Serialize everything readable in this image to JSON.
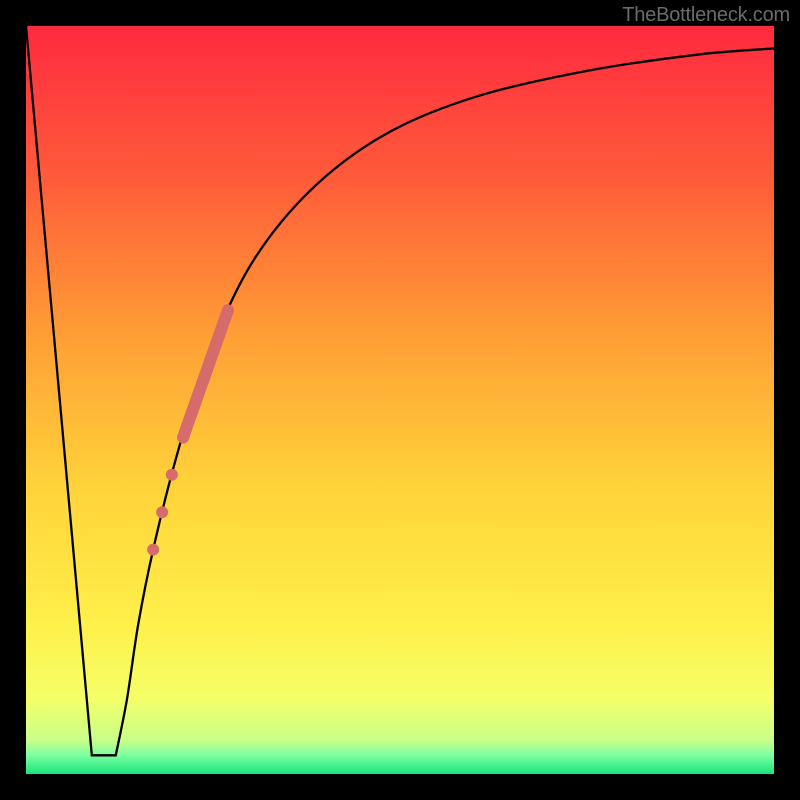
{
  "attribution": "TheBottleneck.com",
  "chart_data": {
    "type": "line",
    "title": "",
    "xlabel": "",
    "ylabel": "",
    "xlim": [
      0,
      100
    ],
    "ylim": [
      0,
      100
    ],
    "gradient": [
      {
        "stop": 0.0,
        "color": "#ff2a3f"
      },
      {
        "stop": 0.2,
        "color": "#ff5a3a"
      },
      {
        "stop": 0.42,
        "color": "#ffa035"
      },
      {
        "stop": 0.62,
        "color": "#ffd43a"
      },
      {
        "stop": 0.8,
        "color": "#fff04a"
      },
      {
        "stop": 0.9,
        "color": "#f4ff68"
      },
      {
        "stop": 0.955,
        "color": "#c9ff8a"
      },
      {
        "stop": 0.975,
        "color": "#7bffa0"
      },
      {
        "stop": 1.0,
        "color": "#18e57e"
      }
    ],
    "left_line": {
      "x0": 0.0,
      "y0": 100.0,
      "x1": 8.8,
      "y1": 2.5
    },
    "valley": {
      "x_start": 8.8,
      "x_end": 12.0,
      "y": 2.5
    },
    "series": [
      {
        "x": 12.0,
        "y": 2.5
      },
      {
        "x": 13.5,
        "y": 10.0
      },
      {
        "x": 15.0,
        "y": 20.0
      },
      {
        "x": 17.0,
        "y": 30.0
      },
      {
        "x": 20.0,
        "y": 42.0
      },
      {
        "x": 24.0,
        "y": 55.0
      },
      {
        "x": 30.0,
        "y": 68.0
      },
      {
        "x": 38.0,
        "y": 78.0
      },
      {
        "x": 48.0,
        "y": 85.5
      },
      {
        "x": 60.0,
        "y": 90.5
      },
      {
        "x": 75.0,
        "y": 94.0
      },
      {
        "x": 90.0,
        "y": 96.2
      },
      {
        "x": 100.0,
        "y": 97.0
      }
    ],
    "highlight_segment": {
      "x0": 21.0,
      "y0": 45.0,
      "x1": 27.0,
      "y1": 62.0,
      "width": 12
    },
    "highlight_dots": [
      {
        "x": 19.5,
        "y": 40.0,
        "r": 6
      },
      {
        "x": 18.2,
        "y": 35.0,
        "r": 6
      },
      {
        "x": 17.0,
        "y": 30.0,
        "r": 6
      }
    ],
    "colors": {
      "curve": "#000000",
      "highlight": "#d66b6b",
      "border": "#000000",
      "attribution": "#6b6b6b"
    }
  }
}
